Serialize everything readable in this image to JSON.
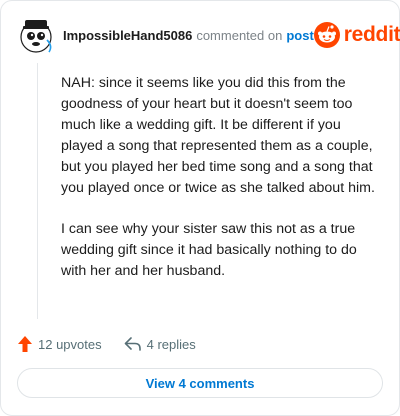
{
  "header": {
    "username": "ImpossibleHand5086",
    "action_text": "commented on",
    "post_link": "post",
    "brand_wordmark": "reddit"
  },
  "comment": {
    "paragraphs": [
      "NAH: since it seems like you did this from the goodness of your heart but it doesn't seem too much like a wedding gift. It be different if you played a song that represented them as a couple, but you played her bed time song and a song that you played once or twice as she talked about him.",
      "I can see why your sister saw this not as a true wedding gift since it had basically nothing to do with her and her husband."
    ]
  },
  "actions": {
    "upvotes": "12 upvotes",
    "replies": "4 replies",
    "upvote_icon": "arrow-up-icon",
    "reply_icon": "reply-arrow-icon"
  },
  "footer": {
    "view_comments": "View 4 comments"
  },
  "colors": {
    "brand": "#ff4500",
    "link": "#0079d3",
    "upvote": "#ff4500",
    "muted": "#7c8388"
  }
}
